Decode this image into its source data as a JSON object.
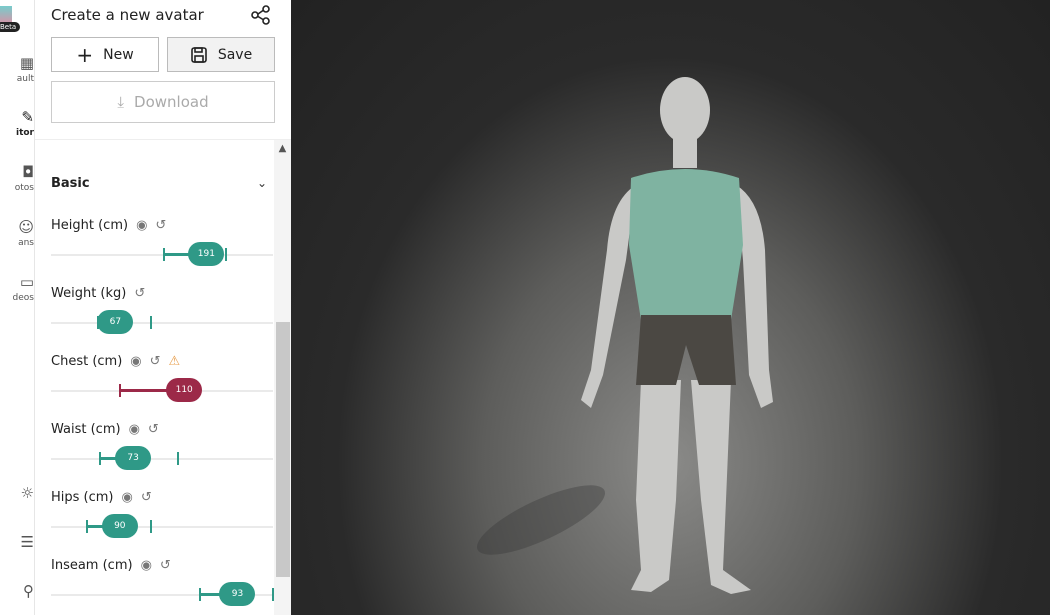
{
  "rail": {
    "badge": "Beta",
    "items": [
      {
        "label": "ault",
        "icon": "grid-icon"
      },
      {
        "label": "itor",
        "icon": "ruler-icon"
      },
      {
        "label": "otos",
        "icon": "camera-icon"
      },
      {
        "label": "ans",
        "icon": "face-scan-icon"
      },
      {
        "label": "deos",
        "icon": "video-icon"
      }
    ],
    "bottom_icons": [
      "sun-icon",
      "layers-icon",
      "user-icon"
    ]
  },
  "panel": {
    "title": "Create a new avatar",
    "new_label": "New",
    "save_label": "Save",
    "download_label": "Download",
    "section": "Basic"
  },
  "colors": {
    "accent": "#2f9987",
    "warning": "#9c2948",
    "viewport": "#2a2a2a"
  },
  "fields": [
    {
      "label": "Height (cm)",
      "value": "191",
      "eye": true,
      "warn": false,
      "pct": 70,
      "min_pct": 51,
      "max_pct": 79,
      "status": "ok"
    },
    {
      "label": "Weight (kg)",
      "value": "67",
      "eye": false,
      "warn": false,
      "pct": 29,
      "min_pct": 21,
      "max_pct": 45,
      "status": "ok"
    },
    {
      "label": "Chest (cm)",
      "value": "110",
      "eye": true,
      "warn": true,
      "pct": 60,
      "min_pct": 31,
      "max_pct": null,
      "status": "warning"
    },
    {
      "label": "Waist (cm)",
      "value": "73",
      "eye": true,
      "warn": false,
      "pct": 37,
      "min_pct": 22,
      "max_pct": 57,
      "status": "ok"
    },
    {
      "label": "Hips (cm)",
      "value": "90",
      "eye": true,
      "warn": false,
      "pct": 31,
      "min_pct": 16,
      "max_pct": 45,
      "status": "ok"
    },
    {
      "label": "Inseam (cm)",
      "value": "93",
      "eye": true,
      "warn": false,
      "pct": 84,
      "min_pct": 67,
      "max_pct": 100,
      "status": "ok"
    }
  ]
}
